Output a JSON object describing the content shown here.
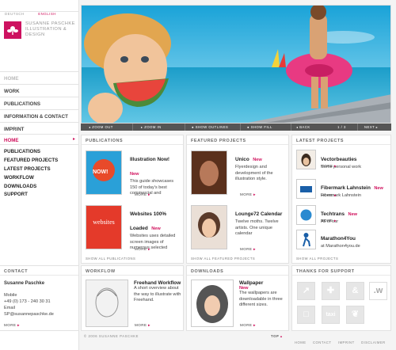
{
  "languages": [
    {
      "label": "Deutsch",
      "active": false
    },
    {
      "label": "English",
      "active": true
    }
  ],
  "brand": {
    "line1": "Susanne Paschke",
    "line2": "Illustration &",
    "line3": "Design"
  },
  "nav": [
    "Home",
    "Work",
    "Publications",
    "Information & Contact",
    "Imprint"
  ],
  "subnav_title": "Home",
  "subnav": [
    "Publications",
    "Featured Projects",
    "Latest Projects",
    "Workflow",
    "Downloads",
    "Support"
  ],
  "toolbar": {
    "zoom_out": "Zoom out",
    "zoom_in": "Zoom in",
    "show_outlines": "Show outlines",
    "show_fill": "Show fill",
    "back": "Back",
    "page": "1 / 3",
    "next": "Next"
  },
  "publications": {
    "header": "Publications",
    "items": [
      {
        "title": "Illustration Now!",
        "new": "New",
        "desc": "This guide showcases 150 of today's best commercial and",
        "more": "More"
      },
      {
        "title": "Websites 100% Loaded",
        "new": "New",
        "desc": "Websites uses detailed screen images of numerous selected",
        "more": "More"
      }
    ],
    "show_all": "Show all publications"
  },
  "featured": {
    "header": "Featured projects",
    "items": [
      {
        "title": "Unico",
        "new": "New",
        "desc": "Flyerdesign and development of the illustration style.",
        "more": "More"
      },
      {
        "title": "Lounge72 Calendar",
        "new": "",
        "desc": "Twelve moths. Twelve artists. One unique calendar",
        "more": "More"
      }
    ],
    "show_all": "Show all featured projects"
  },
  "latest": {
    "header": "Latest Projects",
    "items": [
      {
        "title": "Vectorbeauties",
        "new": "",
        "desc": "Some personal work",
        "more": "More"
      },
      {
        "title": "Fibermark Lahnstein",
        "new": "New",
        "desc": "Fibermark Lahnstein",
        "more": "More"
      },
      {
        "title": "Techtrans",
        "new": "New",
        "desc": "All of our",
        "more": "More"
      },
      {
        "title": "Marathon4You",
        "new": "",
        "desc": "at Marathon4you.de",
        "more": ""
      }
    ],
    "show_all": "Show all projects"
  },
  "contact": {
    "header": "Contact",
    "name": "Susanne Paschke",
    "mobile_label": "Mobile",
    "mobile": "+49 (0) 173 - 240 30 31",
    "email_label": "Email",
    "email": "SP@susannepaschke.de",
    "more": "More"
  },
  "workflow": {
    "header": "Workflow",
    "title": "Freehand Workflow",
    "desc": "A short overview about the way to illustrate with Freehand.",
    "more": "More"
  },
  "downloads": {
    "header": "Downloads",
    "title": "Wallpaper",
    "new": "New",
    "desc": "The wallpapers are downloadable in three different sizes.",
    "more": "More"
  },
  "support": {
    "header": "Thanks for support",
    "icons": [
      "arrow-icon",
      "plus-icon",
      "flame-icon",
      "w-logo-icon",
      "taxi-icon",
      "bird-icon"
    ]
  },
  "footer": {
    "copyright": "© 2006 Susanne Paschke",
    "top": "Top",
    "links": [
      "Home",
      "Contact",
      "Imprint",
      "Disclaimer"
    ]
  },
  "colors": {
    "accent": "#d0105c",
    "toolbar": "#555555"
  }
}
